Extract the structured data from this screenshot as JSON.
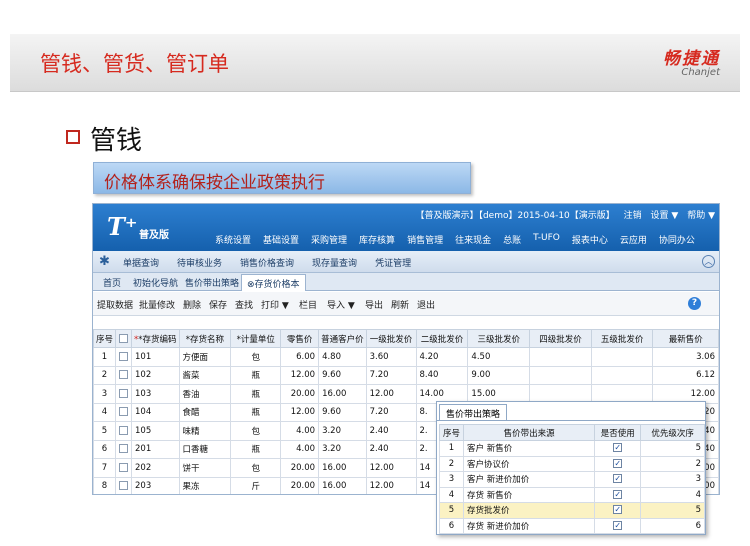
{
  "slide": {
    "title": "管钱、管货、管订单",
    "logo_cn": "畅捷通",
    "logo_en": "Chanjet",
    "section": "管钱",
    "tag": "价格体系确保按企业政策执行"
  },
  "app": {
    "logo": "T⁺",
    "edition": "普及版",
    "status": [
      "【普及版演示】【demo】2015-04-10【演示版】",
      "注销",
      "设置 ▼",
      "帮助 ▼"
    ],
    "menu": [
      "系统设置",
      "基础设置",
      "采购管理",
      "库存核算",
      "销售管理",
      "往来现金",
      "总账",
      "T-UFO",
      "报表中心",
      "云应用",
      "协同办公"
    ],
    "submenu": [
      "单据查询",
      "待审核业务",
      "销售价格查询",
      "现存量查询",
      "凭证管理"
    ],
    "tabs": [
      "首页",
      "初始化导航",
      "售价带出策略",
      "存货价格本"
    ],
    "toolbar": [
      "提取数据",
      "批量修改",
      "删除",
      "保存",
      "查找",
      "打印 ▼",
      "栏目",
      "导入 ▼",
      "导出",
      "刷新",
      "退出"
    ]
  },
  "grid": {
    "headers": [
      "序号",
      "",
      "*存货编码",
      "*存货名称",
      "*计量单位",
      "零售价",
      "普通客户价",
      "一级批发价",
      "二级批发价",
      "三级批发价",
      "四级批发价",
      "五级批发价",
      "最新售价"
    ],
    "rows": [
      [
        "1",
        "101",
        "方便面",
        "包",
        "6.00",
        "4.80",
        "3.60",
        "4.20",
        "4.50",
        "",
        "",
        "3.06"
      ],
      [
        "2",
        "102",
        "酱菜",
        "瓶",
        "12.00",
        "9.60",
        "7.20",
        "8.40",
        "9.00",
        "",
        "",
        "6.12"
      ],
      [
        "3",
        "103",
        "香油",
        "瓶",
        "20.00",
        "16.00",
        "12.00",
        "14.00",
        "15.00",
        "",
        "",
        "12.00"
      ],
      [
        "4",
        "104",
        "食醋",
        "瓶",
        "12.00",
        "9.60",
        "7.20",
        "8.",
        "",
        "",
        "",
        "20"
      ],
      [
        "5",
        "105",
        "味精",
        "包",
        "4.00",
        "3.20",
        "2.40",
        "2.",
        "",
        "",
        "",
        "40"
      ],
      [
        "6",
        "201",
        "口香糖",
        "瓶",
        "4.00",
        "3.20",
        "2.40",
        "2.",
        "",
        "",
        "",
        "40"
      ],
      [
        "7",
        "202",
        "饼干",
        "包",
        "20.00",
        "16.00",
        "12.00",
        "14",
        "",
        "",
        "",
        "00"
      ],
      [
        "8",
        "203",
        "果冻",
        "斤",
        "20.00",
        "16.00",
        "12.00",
        "14",
        "",
        "",
        "",
        "00"
      ]
    ]
  },
  "popup": {
    "tab": "售价带出策略",
    "headers": [
      "序号",
      "售价带出来源",
      "是否使用",
      "优先级次序"
    ],
    "rows": [
      [
        "1",
        "客户  新售价",
        "5"
      ],
      [
        "2",
        "客户协议价",
        "2"
      ],
      [
        "3",
        "客户  新进价加价",
        "3"
      ],
      [
        "4",
        "存货  新售价",
        "4"
      ],
      [
        "5",
        "存货批发价",
        "5"
      ],
      [
        "6",
        "存货  新进价加价",
        "6"
      ]
    ]
  }
}
